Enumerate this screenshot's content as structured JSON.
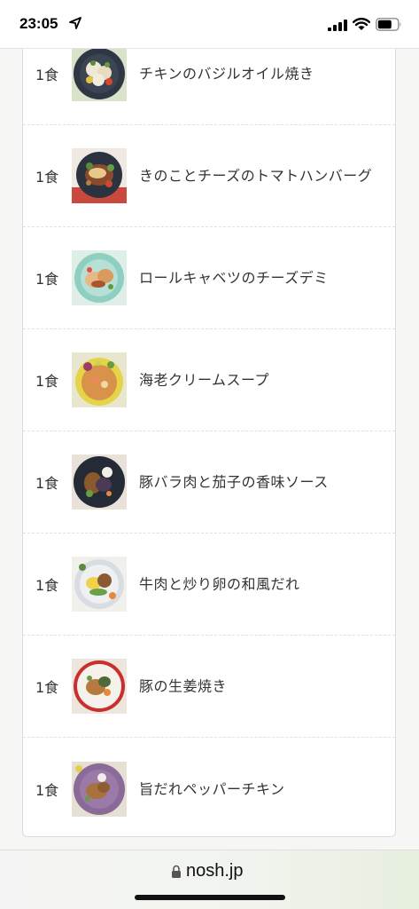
{
  "status_bar": {
    "time": "23:05"
  },
  "menu": {
    "items": [
      {
        "qty": "1食",
        "name": "チキンのバジルオイル焼き",
        "image": "chicken-basil-dish-photo"
      },
      {
        "qty": "1食",
        "name": "きのことチーズのトマトハンバーグ",
        "image": "mushroom-cheese-hamburg-photo"
      },
      {
        "qty": "1食",
        "name": "ロールキャベツのチーズデミ",
        "image": "cabbage-roll-photo"
      },
      {
        "qty": "1食",
        "name": "海老クリームスープ",
        "image": "shrimp-cream-soup-photo"
      },
      {
        "qty": "1食",
        "name": "豚バラ肉と茄子の香味ソース",
        "image": "pork-eggplant-photo"
      },
      {
        "qty": "1食",
        "name": "牛肉と炒り卵の和風だれ",
        "image": "beef-egg-photo"
      },
      {
        "qty": "1食",
        "name": "豚の生姜焼き",
        "image": "pork-ginger-photo"
      },
      {
        "qty": "1食",
        "name": "旨だれペッパーチキン",
        "image": "pepper-chicken-photo"
      }
    ]
  },
  "browser": {
    "domain": "nosh.jp"
  },
  "colors": {
    "accent_bar": "#e7efdf",
    "text": "#333333"
  }
}
